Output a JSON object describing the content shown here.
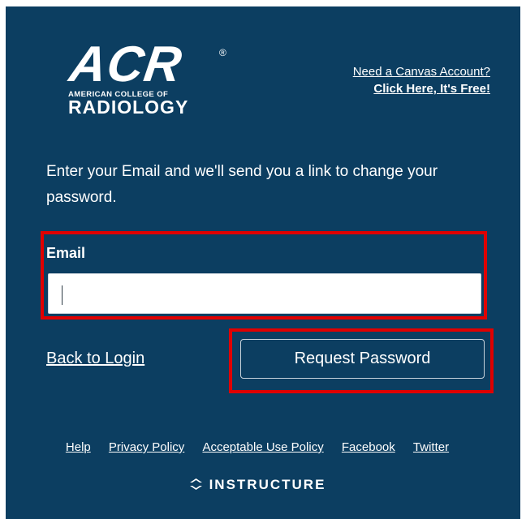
{
  "logo": {
    "main": "ACR",
    "registered": "®",
    "subtitle": "AMERICAN COLLEGE OF",
    "radiology": "RADIOLOGY"
  },
  "account": {
    "line1": "Need a Canvas Account?",
    "line2": "Click Here, It's Free!"
  },
  "instructions": "Enter your Email and we'll send you a link to change your password.",
  "email": {
    "label": "Email",
    "value": "",
    "placeholder": ""
  },
  "actions": {
    "back_label": "Back to Login",
    "request_label": "Request Password"
  },
  "footer": {
    "links": [
      "Help",
      "Privacy Policy",
      "Acceptable Use Policy",
      "Facebook",
      "Twitter"
    ],
    "brand": "INSTRUCTURE"
  },
  "colors": {
    "background": "#0c3e61",
    "highlight": "#e00000"
  },
  "icons": {
    "brand": "instructure-icon"
  }
}
